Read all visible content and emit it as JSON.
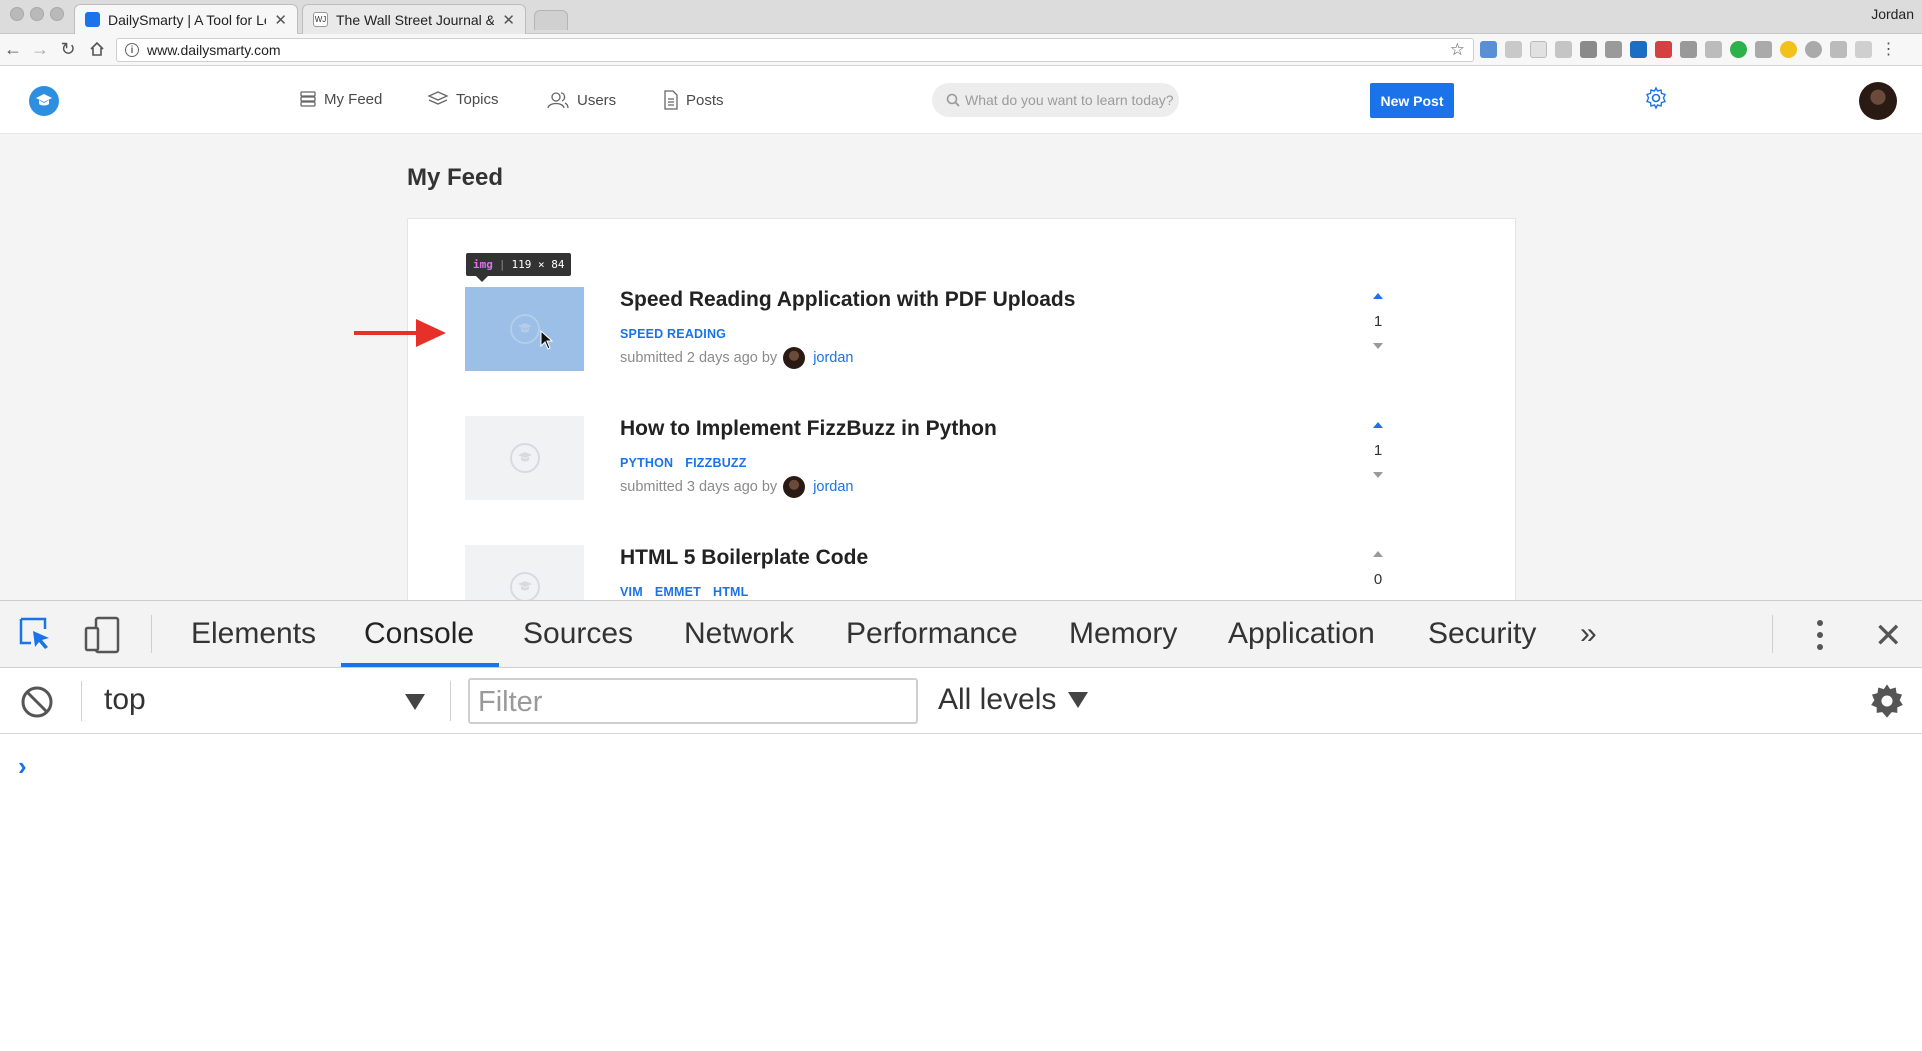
{
  "browser": {
    "user": "Jordan",
    "tabs": [
      {
        "title": "DailySmarty | A Tool for Learning",
        "active": true
      },
      {
        "title": "The Wall Street Journal & Breaking News",
        "active": false
      }
    ],
    "url": "www.dailysmarty.com"
  },
  "site": {
    "nav": [
      {
        "label": "My Feed",
        "icon": "stack-icon"
      },
      {
        "label": "Topics",
        "icon": "layers-icon"
      },
      {
        "label": "Users",
        "icon": "users-icon"
      },
      {
        "label": "Posts",
        "icon": "document-icon"
      }
    ],
    "search_placeholder": "What do you want to learn today?",
    "new_post_label": "New Post",
    "feed_title": "My Feed",
    "posts": [
      {
        "title": "Speed Reading Application with PDF Uploads",
        "tags": [
          "SPEED READING"
        ],
        "meta": "submitted 2 days ago by",
        "author": "jordan",
        "votes": "1",
        "upvoted": true
      },
      {
        "title": "How to Implement FizzBuzz in Python",
        "tags": [
          "PYTHON",
          "FIZZBUZZ"
        ],
        "meta": "submitted 3 days ago by",
        "author": "jordan",
        "votes": "1",
        "upvoted": true
      },
      {
        "title": "HTML 5 Boilerplate Code",
        "tags": [
          "VIM",
          "EMMET",
          "HTML"
        ],
        "meta": "",
        "author": "",
        "votes": "0",
        "upvoted": false
      }
    ],
    "inspect_tooltip": {
      "tag": "img",
      "size": "119 × 84"
    }
  },
  "devtools": {
    "tabs": [
      "Elements",
      "Console",
      "Sources",
      "Network",
      "Performance",
      "Memory",
      "Application",
      "Security"
    ],
    "active_tab": "Console",
    "more_label": "»",
    "context": "top",
    "filter_placeholder": "Filter",
    "levels": "All levels",
    "prompt": "›"
  },
  "colors": {
    "accent": "#1a73e8",
    "highlight": "#9bbfe6",
    "arrow": "#e8302a"
  }
}
